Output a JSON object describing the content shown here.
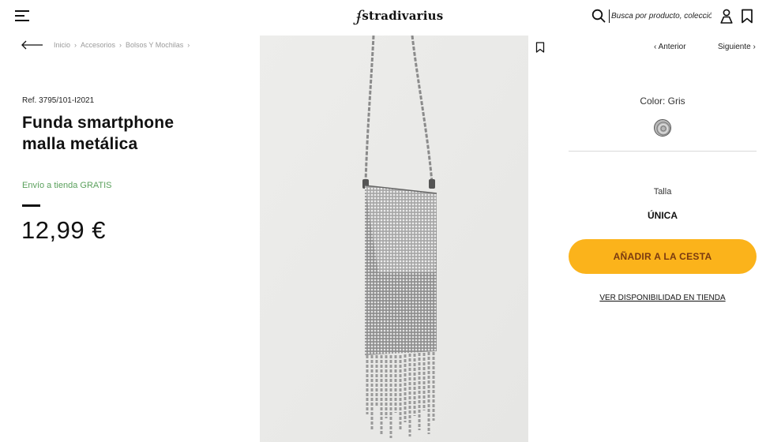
{
  "header": {
    "logo_text": "stradivarius",
    "logo_mark": "ʄ",
    "search_placeholder": "Busca por producto, colección...",
    "icons": [
      "menu-icon",
      "search-icon",
      "user-icon",
      "bookmark-icon"
    ]
  },
  "breadcrumb": {
    "items": [
      "Inicio",
      "Accesorios",
      "Bolsos Y Mochilas"
    ],
    "separator": "›"
  },
  "product": {
    "ref": "Ref. 3795/101-I2021",
    "title": "Funda smartphone malla metálica",
    "shipping": "Envío a tienda GRATIS",
    "price": "12,99 €",
    "image_alt": "Funda smartphone malla metálica"
  },
  "navigation": {
    "prev": "Anterior",
    "next": "Siguiente"
  },
  "options": {
    "color_label": "Color: Gris",
    "size_label": "Talla",
    "size_value": "ÚNICA"
  },
  "actions": {
    "add_to_cart": "AÑADIR A LA CESTA",
    "store_availability": "VER DISPONIBILIDAD EN TIENDA"
  },
  "colors": {
    "accent_button": "#fbb31b",
    "button_text": "#7a3a10",
    "shipping_green": "#5aa05c",
    "image_background": "#ebebe9"
  }
}
